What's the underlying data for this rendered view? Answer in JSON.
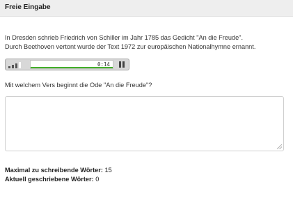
{
  "header": {
    "title": "Freie Eingabe"
  },
  "intro": {
    "line1": "In Dresden schrieb Friedrich von Schiller im Jahr 1785 das Gedicht \"An die Freude\".",
    "line2": "Durch Beethoven vertont wurde der Text 1972 zur europäischen Nationalhymne ernannt."
  },
  "player": {
    "time": "0:14",
    "progress": 1.0,
    "volume_level": 3,
    "volume_max": 4,
    "accent_color": "#43b02a",
    "button_icon": "pause-icon"
  },
  "question": {
    "text": "Mit welchem Vers beginnt die Ode \"An die Freude\"?"
  },
  "answer": {
    "value": ""
  },
  "stats": {
    "max_label": "Maximal zu schreibende Wörter:",
    "max_value": "15",
    "current_label": "Aktuell geschriebene Wörter:",
    "current_value": "0"
  }
}
